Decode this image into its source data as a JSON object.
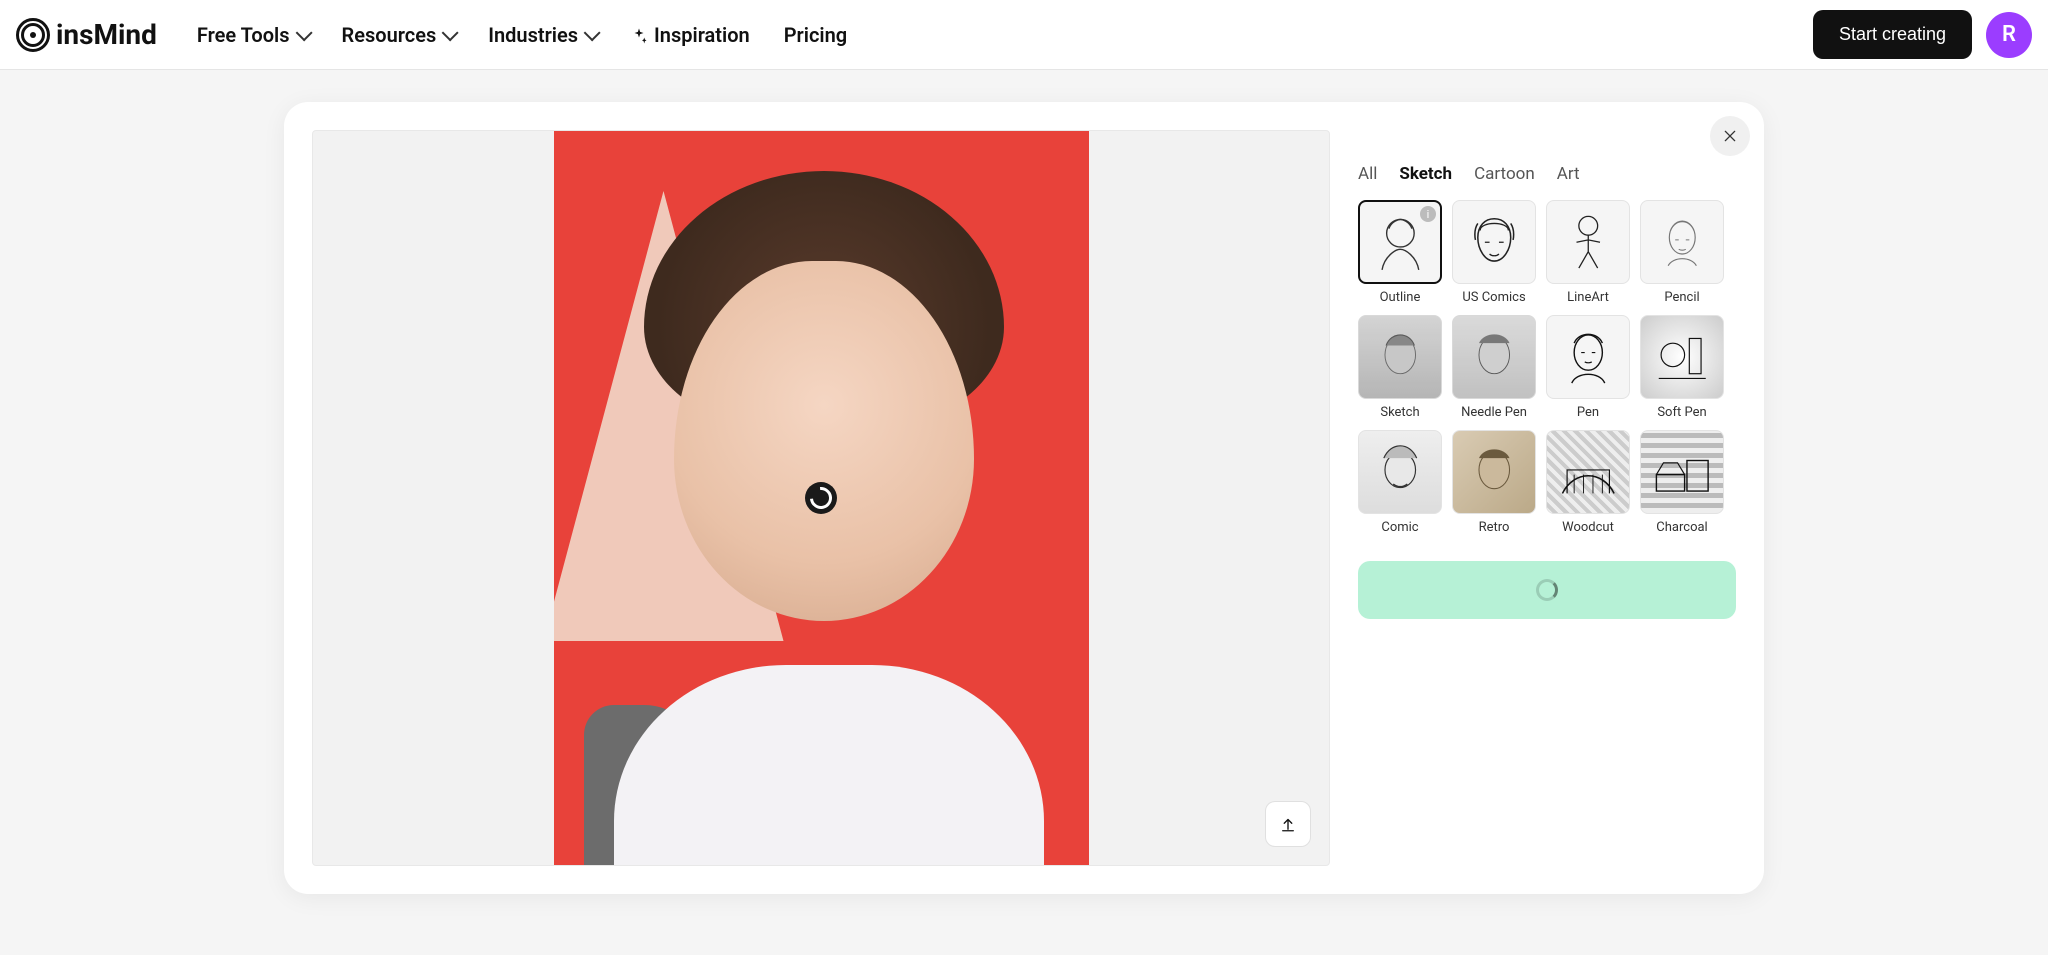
{
  "brand": "insMind",
  "nav": {
    "free_tools": "Free Tools",
    "resources": "Resources",
    "industries": "Industries",
    "inspiration": "Inspiration",
    "pricing": "Pricing"
  },
  "header": {
    "start_button": "Start creating",
    "avatar_initial": "R"
  },
  "tabs": {
    "all": "All",
    "sketch": "Sketch",
    "cartoon": "Cartoon",
    "art": "Art",
    "active": "Sketch"
  },
  "styles": [
    {
      "id": "outline",
      "label": "Outline",
      "selected": true,
      "info_badge": true
    },
    {
      "id": "us-comics",
      "label": "US Comics"
    },
    {
      "id": "lineart",
      "label": "LineArt"
    },
    {
      "id": "pencil",
      "label": "Pencil"
    },
    {
      "id": "sketch",
      "label": "Sketch"
    },
    {
      "id": "needle-pen",
      "label": "Needle Pen"
    },
    {
      "id": "pen",
      "label": "Pen"
    },
    {
      "id": "soft-pen",
      "label": "Soft Pen"
    },
    {
      "id": "comic",
      "label": "Comic"
    },
    {
      "id": "retro",
      "label": "Retro"
    },
    {
      "id": "woodcut",
      "label": "Woodcut"
    },
    {
      "id": "charcoal",
      "label": "Charcoal"
    }
  ]
}
